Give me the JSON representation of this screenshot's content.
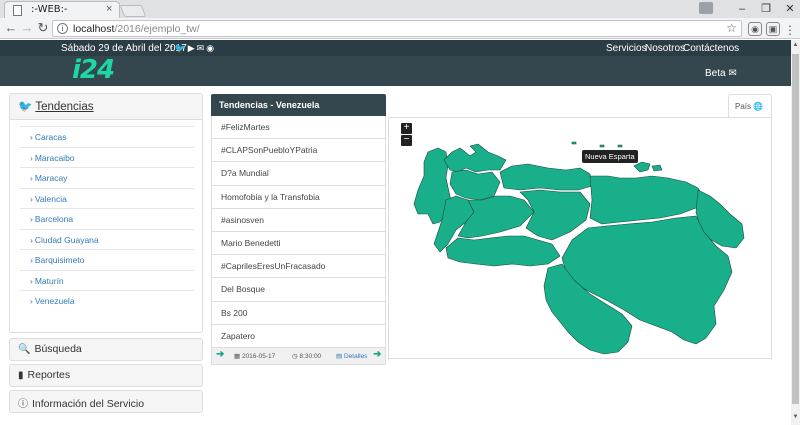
{
  "browser": {
    "tab_title": ":-WEB:-",
    "url_host": "localhost",
    "url_path": "/2016/ejemplo_tw/"
  },
  "site": {
    "date": "Sábado 29 de Abril del 2017",
    "logo": "i24",
    "menu": [
      "Servicios",
      "Nosotros",
      "Contáctenos"
    ],
    "beta": "Beta"
  },
  "sidebar": {
    "title": "Tendencias",
    "cities": [
      "Caracas",
      "Maracaibo",
      "Maracay",
      "Valencia",
      "Barcelona",
      "Ciudad Guayana",
      "Barquisimeto",
      "Maturín",
      "Venezuela"
    ],
    "sections": [
      "Búsqueda",
      "Reportes",
      "Información del Servicio"
    ]
  },
  "trends": {
    "title": "Tendencias - Venezuela",
    "items": [
      "#FelizMartes",
      "#CLAPSonPuebloYPatria",
      "D?a Mundial",
      "Homofobia y la Transfobia",
      "#asinosven",
      "Mario Benedetti",
      "#CaprilesEresUnFracasado",
      "Del Bosque",
      "Bs 200",
      "Zapatero"
    ],
    "date": "2016-05-17",
    "time": "8:30:00",
    "details": "Detalles"
  },
  "map": {
    "tab_label": "País",
    "tooltip": "Nueva Esparta",
    "fill_color": "#1aaf8b"
  },
  "colors": {
    "header_bg": "#34474f",
    "accent": "#1ed6a4",
    "link": "#337ab7"
  }
}
